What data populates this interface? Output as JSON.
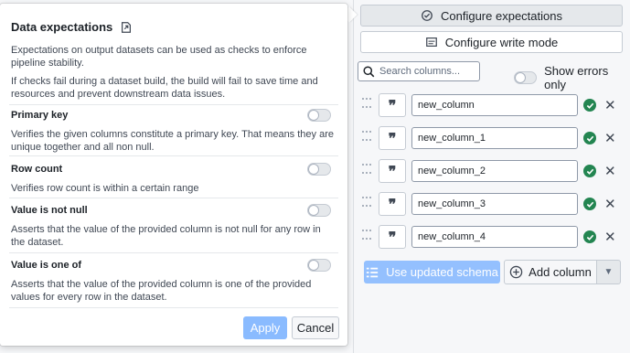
{
  "right_panel": {
    "configure_expectations_label": "Configure expectations",
    "configure_write_mode_label": "Configure write mode",
    "search_placeholder": "Search columns...",
    "show_errors_label": "Show errors only",
    "columns": [
      {
        "name": "new_column",
        "valid": true
      },
      {
        "name": "new_column_1",
        "valid": true
      },
      {
        "name": "new_column_2",
        "valid": true
      },
      {
        "name": "new_column_3",
        "valid": true
      },
      {
        "name": "new_column_4",
        "valid": true
      }
    ],
    "use_updated_schema_label": "Use updated schema",
    "add_column_label": "Add column"
  },
  "popover": {
    "title": "Data expectations",
    "description_1": "Expectations on output datasets can be used as checks to enforce pipeline stability.",
    "description_2": "If checks fail during a dataset build, the build will fail to save time and resources and prevent downstream data issues.",
    "expectations": [
      {
        "name": "Primary key",
        "description": "Verifies the given columns constitute a primary key. That means they are unique together and all non null.",
        "enabled": false
      },
      {
        "name": "Row count",
        "description": "Verifies row count is within a certain range",
        "enabled": false
      },
      {
        "name": "Value is not null",
        "description": "Asserts that the value of the provided column is not null for any row in the dataset.",
        "enabled": false
      },
      {
        "name": "Value is one of",
        "description": "Asserts that the value of the provided column is one of the provided values for every row in the dataset.",
        "enabled": false
      }
    ],
    "apply_label": "Apply",
    "cancel_label": "Cancel"
  },
  "colors": {
    "primary_disabled": "#8abbff",
    "success": "#238551",
    "border": "#c5cbd3"
  }
}
